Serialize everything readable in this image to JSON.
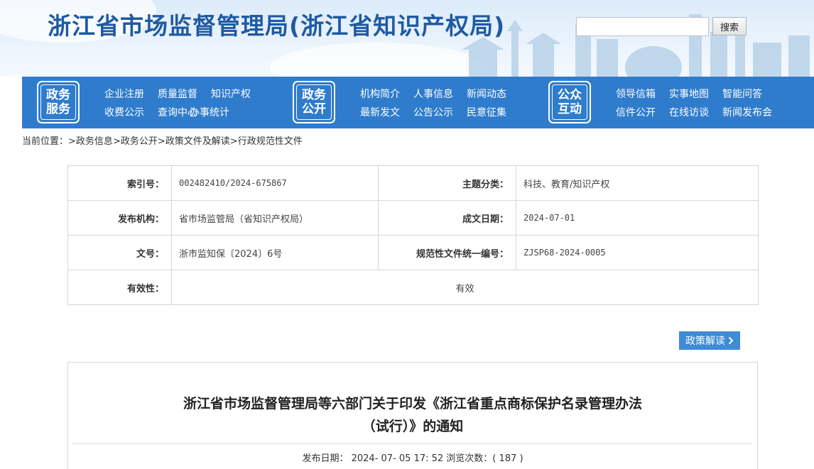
{
  "header": {
    "site_title": "浙江省市场监督管理局(浙江省知识产权局)",
    "search": {
      "placeholder": "",
      "value": "",
      "button_label": "搜索"
    }
  },
  "nav": {
    "groups": [
      {
        "badge_line1": "政务",
        "badge_line2": "服务",
        "links": [
          "企业注册",
          "质量监督",
          "知识产权",
          "收费公示",
          "查询中心",
          "办事统计"
        ]
      },
      {
        "badge_line1": "政务",
        "badge_line2": "公开",
        "links": [
          "机构简介",
          "人事信息",
          "新闻动态",
          "最新发文",
          "公告公示",
          "民意征集"
        ]
      },
      {
        "badge_line1": "公众",
        "badge_line2": "互动",
        "links": [
          "领导信箱",
          "实事地图",
          "智能问答",
          "信件公开",
          "在线访谈",
          "新闻发布会"
        ]
      }
    ]
  },
  "breadcrumb": {
    "prefix": "当前位置：",
    "items": [
      "政务信息",
      "政务公开",
      "政策文件及解读",
      "行政规范性文件"
    ],
    "separator": ">"
  },
  "meta": {
    "index_label": "索引号：",
    "index_value": "002482410/2024-675867",
    "topic_label": "主题分类：",
    "topic_value": "科技、教育/知识产权",
    "issuer_label": "发布机构：",
    "issuer_value": "省市场监管局（省知识产权局）",
    "date_label": "成文日期：",
    "date_value": "2024-07-01",
    "docno_label": "文号：",
    "docno_value": "浙市监知保〔2024〕6号",
    "code_label": "规范性文件统一编号：",
    "code_value": "ZJSP68-2024-0005",
    "validity_label": "有效性：",
    "validity_value": "有效"
  },
  "policy_button": {
    "label": "政策解读",
    "icon": "chevron-right-icon"
  },
  "article": {
    "title_line1": "浙江省市场监督管理局等六部门关于印发《浙江省重点商标保护名录管理办法",
    "title_line2": "（试行）》的通知",
    "meta_text": "发布日期： 2024- 07- 05 17: 52 浏览次数：( 187 )"
  },
  "colors": {
    "nav_bg": "#2f7ccc",
    "title_blue": "#1f5aa3",
    "button_blue": "#3e8bd7"
  }
}
